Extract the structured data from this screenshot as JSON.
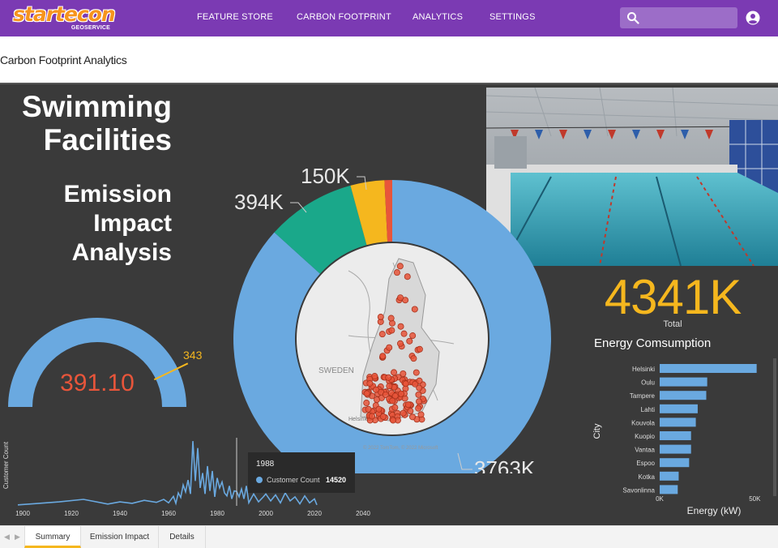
{
  "nav": {
    "logo_text": "startecon",
    "logo_sub": "GEOSERVICE",
    "links": [
      "FEATURE STORE",
      "CARBON FOOTPRINT",
      "ANALYTICS",
      "SETTINGS"
    ],
    "search_placeholder": "",
    "search_icon": "search-icon",
    "user_icon": "account-circle-icon",
    "bg_color": "#7b3ab3"
  },
  "page_title": "Carbon Footprint Analytics",
  "report": {
    "headline": [
      "Swimming",
      "Facilities"
    ],
    "subheadline": [
      "Emission",
      "Impact",
      "Analysis"
    ],
    "gauge": {
      "value": "391.10",
      "target": "343",
      "value_number": 391.1,
      "target_number": 343,
      "max_number": 400
    },
    "donut": {
      "labels": [
        "3763K",
        "394K",
        "150K"
      ],
      "values": [
        3763,
        394,
        150,
        34
      ],
      "colors": [
        "#6aa9e0",
        "#1aa88a",
        "#f5b71e",
        "#e8553a"
      ]
    },
    "map": {
      "country_label": "SWEDEN",
      "city_label": "Helsinki",
      "attribution": "© 2022 TomTom, © 2022 Microsoft"
    },
    "total": {
      "value": "4341K",
      "label": "Total"
    },
    "energy_title": "Energy Comsumption",
    "tooltip": {
      "year": "1988",
      "label": "Customer Count",
      "value": "14520"
    },
    "accent_color": "#f5b71e"
  },
  "chart_data": [
    {
      "type": "bar",
      "orientation": "horizontal",
      "categories": [
        "Helsinki",
        "Oulu",
        "Tampere",
        "Lahti",
        "Kouvola",
        "Kuopio",
        "Vantaa",
        "Espoo",
        "Kotka",
        "Savonlinna"
      ],
      "values": [
        51000,
        25000,
        24500,
        20000,
        19000,
        16500,
        16500,
        15500,
        10000,
        9500
      ],
      "xlabel": "Energy (kW)",
      "ylabel": "City",
      "xticks": [
        "0K",
        "50K"
      ],
      "xlim": [
        0,
        52000
      ],
      "color": "#6aa9e0"
    },
    {
      "type": "line",
      "ylabel": "Customer Count",
      "xticks": [
        "1900",
        "1920",
        "1940",
        "1960",
        "1980",
        "2000",
        "2020",
        "2040"
      ],
      "xlim": [
        1898,
        2045
      ],
      "ylim": [
        0,
        70000
      ],
      "highlight_year": 1988,
      "x": [
        1898,
        1905,
        1915,
        1925,
        1935,
        1940,
        1945,
        1950,
        1955,
        1958,
        1960,
        1962,
        1963,
        1964,
        1965,
        1966,
        1967,
        1968,
        1969,
        1970,
        1971,
        1972,
        1973,
        1974,
        1975,
        1976,
        1977,
        1978,
        1979,
        1980,
        1981,
        1982,
        1983,
        1984,
        1985,
        1986,
        1987,
        1988,
        1989,
        1990,
        1991,
        1992,
        1993,
        1995,
        1997,
        1999,
        2000,
        2002,
        2004,
        2006,
        2008,
        2010,
        2012,
        2014,
        2016,
        2018,
        2020,
        2021
      ],
      "y": [
        1000,
        2200,
        4000,
        6500,
        1800,
        4000,
        2500,
        5500,
        3500,
        6500,
        3000,
        9500,
        2500,
        13000,
        8500,
        21000,
        14000,
        26000,
        12000,
        65000,
        25000,
        58000,
        18000,
        33000,
        12000,
        40000,
        15000,
        35000,
        9000,
        28000,
        18000,
        24000,
        13000,
        10000,
        20000,
        7000,
        15000,
        14520,
        9000,
        17000,
        7000,
        20000,
        3000,
        12000,
        4000,
        9000,
        12000,
        5000,
        11000,
        3000,
        13000,
        5000,
        9000,
        2000,
        10000,
        3000,
        7000,
        1000
      ],
      "color": "#6aa9e0"
    }
  ],
  "tabs": [
    "Summary",
    "Emission Impact",
    "Details"
  ]
}
